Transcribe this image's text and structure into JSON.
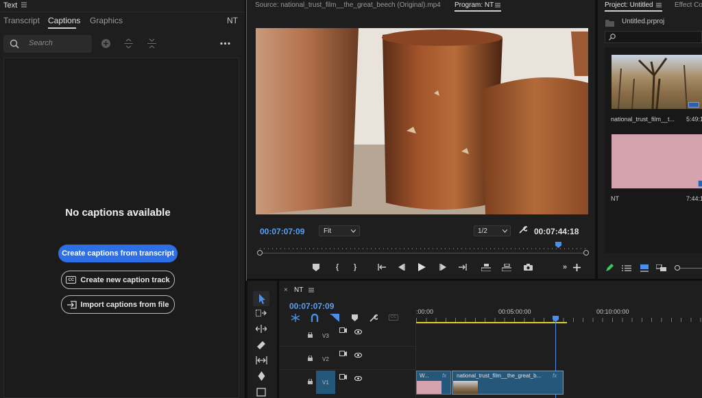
{
  "text_panel": {
    "title": "Text",
    "tabs": [
      "Transcript",
      "Captions",
      "Graphics"
    ],
    "active_tab": "Captions",
    "sequence_label": "NT",
    "search_placeholder": "Search",
    "empty_message": "No captions available",
    "btn_create_from_transcript": "Create captions from transcript",
    "btn_new_track": "Create new caption track",
    "btn_import": "Import captions from file",
    "cc_badge": "CC"
  },
  "monitor": {
    "source_tab": "Source: national_trust_film__the_great_beech (Original).mp4",
    "program_tab": "Program: NT",
    "timecode_current": "00:07:07:09",
    "fit_select": "Fit",
    "resolution_select": "1/2",
    "timecode_duration": "00:07:44:18"
  },
  "project": {
    "tab_project": "Project: Untitled",
    "tab_effects": "Effect Cor",
    "file_name": "Untitled.prproj",
    "items": [
      {
        "name": "national_trust_film__t...",
        "duration": "5:49:1"
      },
      {
        "name": "NT",
        "duration": "7:44:1"
      }
    ]
  },
  "timeline": {
    "sequence_name": "NT",
    "timecode": "00:07:07:09",
    "ruler": [
      ":00:00",
      "00:05:00:00",
      "00:10:00:00"
    ],
    "tracks": [
      {
        "label": "V3"
      },
      {
        "label": "V2"
      },
      {
        "label": "V1"
      }
    ],
    "clips": [
      {
        "label": "W...",
        "fx": "fx"
      },
      {
        "label": "national_trust_film__the_great_b...",
        "fx": "fx"
      }
    ],
    "cc_badge": "CC"
  },
  "colors": {
    "accent_blue": "#2f6fe6",
    "timecode_blue": "#5aa0f0",
    "clip_blue": "#24577a",
    "pink_matte": "#d4a3ae",
    "work_area_yellow": "#e3d02b"
  }
}
